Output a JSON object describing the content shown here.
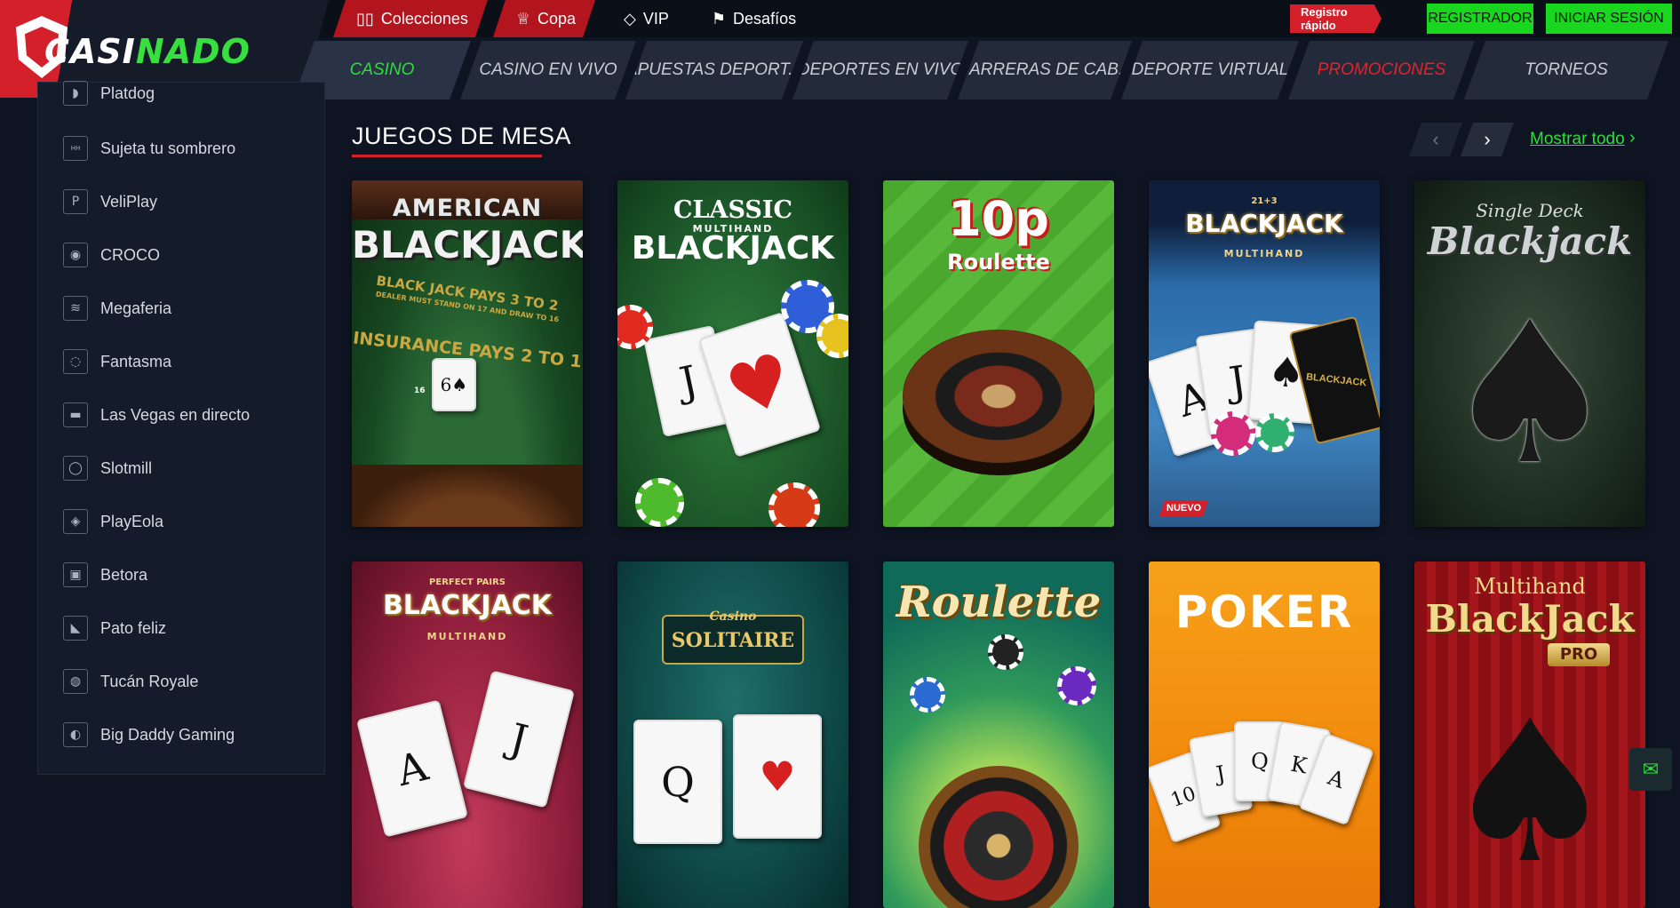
{
  "brand": {
    "logo_part1": "CASI",
    "logo_part2": "NADO"
  },
  "top_links": [
    {
      "label": "Colecciones",
      "icon": "book-icon"
    },
    {
      "label": "Copa",
      "icon": "trophy-icon"
    },
    {
      "label": "VIP",
      "icon": "diamond-icon"
    },
    {
      "label": "Desafíos",
      "icon": "flag-icon"
    }
  ],
  "auth": {
    "quick_register": "Registro rápido",
    "register": "REGISTRADOR",
    "login": "INICIAR SESIÓN"
  },
  "nav": [
    {
      "label": "CASINO",
      "state": "active"
    },
    {
      "label": "CASINO EN VIVO"
    },
    {
      "label": "APUESTAS DEPORT..."
    },
    {
      "label": "DEPORTES EN VIVO"
    },
    {
      "label": "CARRERAS DE CAB..."
    },
    {
      "label": "DEPORTE VIRTUAL"
    },
    {
      "label": "PROMOCIONES",
      "state": "highlight"
    },
    {
      "label": "TORNEOS"
    }
  ],
  "sidebar": {
    "items": [
      {
        "label": "Platdog",
        "icon": "platdog-icon"
      },
      {
        "label": "Sujeta tu sombrero",
        "icon": "hold-your-hat-icon"
      },
      {
        "label": "VeliPlay",
        "icon": "veliplay-icon"
      },
      {
        "label": "CROCO",
        "icon": "croco-icon"
      },
      {
        "label": "Megaferia",
        "icon": "megaferia-icon"
      },
      {
        "label": "Fantasma",
        "icon": "ghost-icon"
      },
      {
        "label": "Las Vegas en directo",
        "icon": "vegas-icon"
      },
      {
        "label": "Slotmill",
        "icon": "slotmill-icon"
      },
      {
        "label": "PlayEola",
        "icon": "playeola-icon"
      },
      {
        "label": "Betora",
        "icon": "betora-icon"
      },
      {
        "label": "Pato feliz",
        "icon": "duck-icon"
      },
      {
        "label": "Tucán Royale",
        "icon": "toucan-icon"
      },
      {
        "label": "Big Daddy Gaming",
        "icon": "big-daddy-icon"
      }
    ]
  },
  "section": {
    "title": "JUEGOS DE MESA",
    "show_all": "Mostrar todo"
  },
  "games_row1": [
    {
      "line1": "AMERICAN",
      "line2": "BLACKJACK",
      "felt1": "BLACK JACK PAYS 3 TO 2",
      "felt2": "DEALER MUST STAND ON 17 AND DRAW TO 16",
      "felt3": "INSURANCE PAYS 2 TO 1",
      "count": "16"
    },
    {
      "line1": "CLASSIC",
      "line1b": "MULTIHAND",
      "line2": "BLACKJACK"
    },
    {
      "line1": "10p",
      "line2": "Roulette"
    },
    {
      "line0": "21+3",
      "line1": "BLACKJACK",
      "line2": "MULTIHAND",
      "card_logo": "BLACKJACK",
      "badge": "NUEVO"
    },
    {
      "line1": "Single Deck",
      "line2": "Blackjack"
    }
  ],
  "games_row2": [
    {
      "line0": "PERFECT PAIRS",
      "line1": "BLACKJACK",
      "line2": "MULTIHAND"
    },
    {
      "line1": "Casino",
      "line2": "SOLITAIRE"
    },
    {
      "line1": "Roulette"
    },
    {
      "line1": "POKER"
    },
    {
      "line1": "Multihand",
      "line2": "BlackJack",
      "line3": "PRO"
    }
  ],
  "card_glyphs": {
    "ace": "A",
    "jack": "J",
    "queen": "Q",
    "king": "K",
    "ten": "10",
    "six": "6",
    "spade": "♠",
    "heart": "♥"
  },
  "arrows": {
    "prev": "‹",
    "next": "›",
    "chevron": "›"
  },
  "chat": {
    "icon": "chat-icon",
    "glyph": "✉"
  }
}
